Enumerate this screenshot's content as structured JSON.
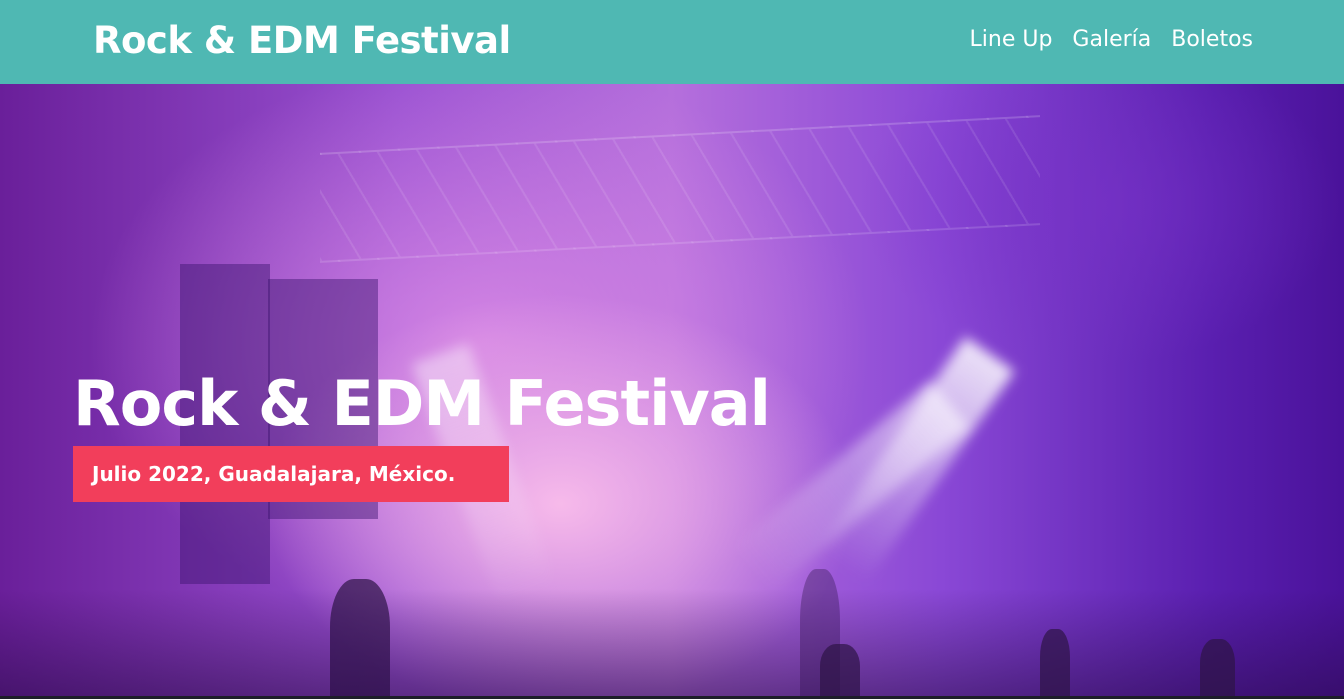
{
  "header": {
    "site_title": "Rock & EDM Festival",
    "background_color": "#4fb8b3",
    "nav": [
      {
        "label": "Line Up"
      },
      {
        "label": "Galería"
      },
      {
        "label": "Boletos"
      }
    ]
  },
  "hero": {
    "title": "Rock & EDM Festival",
    "subtitle": "Julio 2022, Guadalajara, México.",
    "badge_color": "#f23e5b",
    "background": "concert stage photo with purple/pink lighting"
  }
}
